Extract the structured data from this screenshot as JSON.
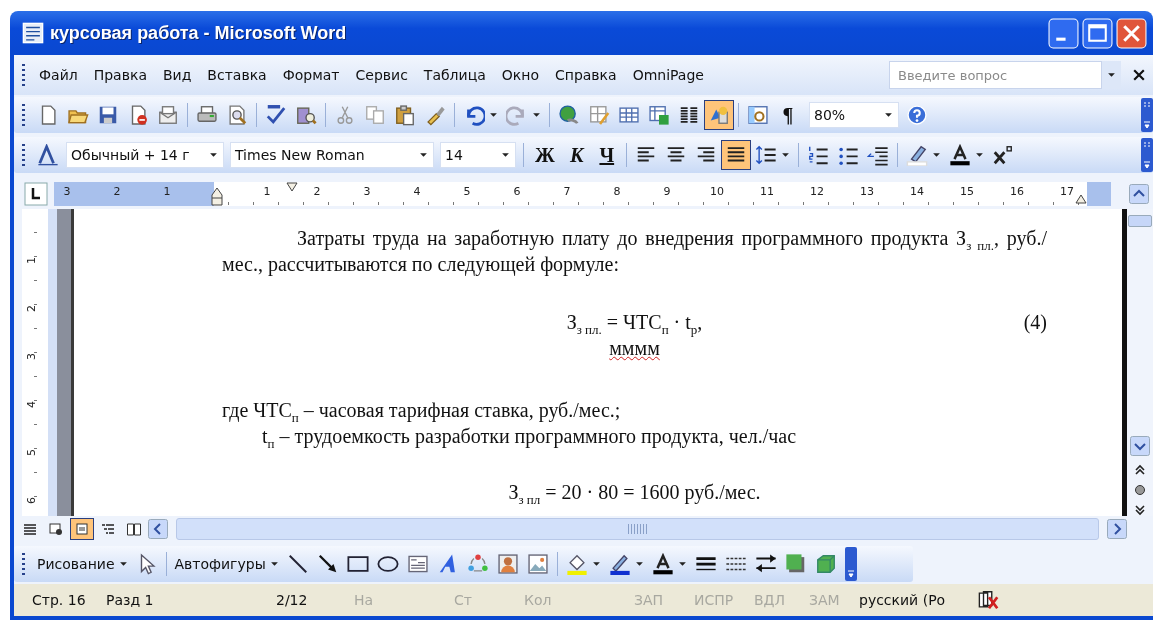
{
  "window": {
    "title": "курсовая работа - Microsoft Word"
  },
  "menu": {
    "items": [
      "Файл",
      "Правка",
      "Вид",
      "Вставка",
      "Формат",
      "Сервис",
      "Таблица",
      "Окно",
      "Справка",
      "OmniPage"
    ],
    "help_search": {
      "placeholder": "Введите вопрос"
    }
  },
  "standard_toolbar": {
    "drawing_button_pressed": true,
    "pilcrow": "¶",
    "zoom": "80%"
  },
  "formatting_toolbar": {
    "style": "Обычный + 14 г",
    "font": "Times New Roman",
    "size": "14",
    "font_style_buttons": [
      {
        "label": "Ж",
        "kind": "bold"
      },
      {
        "label": "К",
        "kind": "italic"
      },
      {
        "label": "Ч",
        "kind": "underline"
      }
    ],
    "alignment_buttons": [
      {
        "selected": false
      },
      {
        "selected": false
      },
      {
        "selected": false
      },
      {
        "selected": true
      }
    ]
  },
  "horizontal_ruler": {
    "left_labels": [
      "3",
      "2",
      "1"
    ],
    "labels": [
      "1",
      "2",
      "3",
      "4",
      "5",
      "6",
      "7",
      "8",
      "9",
      "10",
      "11",
      "12",
      "13",
      "14",
      "15",
      "16",
      "17"
    ]
  },
  "vertical_ruler": {
    "labels": [
      "1",
      "2",
      "3",
      "4",
      "5",
      "6"
    ]
  },
  "document": {
    "blocks": [
      {
        "kind": "paragraph",
        "text": "Затраты труда на заработную плату до внедрения программного продукта З$_{з пл.}$, руб./мес., рассчитываются по следующей формуле:"
      },
      {
        "kind": "formula",
        "text": "З$_{з пл.}$ = ЧТС$_{п}$ · t$_{р}$,",
        "number": "(4)"
      },
      {
        "kind": "centered",
        "text": "мммм",
        "spelling_error": true
      },
      {
        "kind": "line",
        "text": "где ЧТС$_{п}$ – часовая тарифная ставка, руб./мес.;"
      },
      {
        "kind": "indented",
        "text": "t$_{п}$ – трудоемкость разработки программного продукта, чел./час"
      },
      {
        "kind": "result",
        "text": "З$_{з пл}$ = 20 · 80 = 1600 руб./мес."
      }
    ]
  },
  "view_buttons": [
    {
      "selected": false
    },
    {
      "selected": false
    },
    {
      "selected": true
    },
    {
      "selected": false
    },
    {
      "selected": false
    }
  ],
  "drawing_toolbar": {
    "draw_menu": "Рисование",
    "autoshapes_menu": "Автофигуры"
  },
  "status_bar": {
    "items": [
      {
        "text": "Стр. 16",
        "disabled": false
      },
      {
        "text": "Разд 1",
        "disabled": false
      },
      {
        "text": "2/12",
        "disabled": false
      },
      {
        "text": "На",
        "disabled": true
      },
      {
        "text": "Ст",
        "disabled": true
      },
      {
        "text": "Кол",
        "disabled": true
      },
      {
        "text": "ЗАП",
        "disabled": true
      },
      {
        "text": "ИСПР",
        "disabled": true
      },
      {
        "text": "ВДЛ",
        "disabled": true
      },
      {
        "text": "ЗАМ",
        "disabled": true
      },
      {
        "text": "русский (Ро",
        "disabled": false
      }
    ]
  }
}
